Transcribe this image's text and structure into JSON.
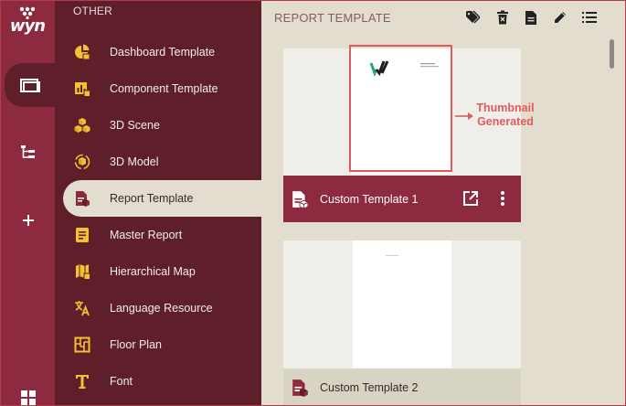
{
  "app": {
    "logo_text": "wyn"
  },
  "rail": {
    "items": [
      "folder-icon",
      "hierarchy-icon",
      "plus-icon",
      "grid-icon"
    ]
  },
  "categories": {
    "title": "OTHER",
    "items": [
      {
        "label": "Dashboard Template",
        "icon": "pie-chart-icon"
      },
      {
        "label": "Component Template",
        "icon": "bar-chart-icon"
      },
      {
        "label": "3D Scene",
        "icon": "cubes-icon"
      },
      {
        "label": "3D Model",
        "icon": "cube-icon"
      },
      {
        "label": "Report Template",
        "icon": "report-icon",
        "active": true
      },
      {
        "label": "Master Report",
        "icon": "master-report-icon"
      },
      {
        "label": "Hierarchical Map",
        "icon": "map-icon"
      },
      {
        "label": "Language Resource",
        "icon": "translate-icon"
      },
      {
        "label": "Floor Plan",
        "icon": "floor-plan-icon"
      },
      {
        "label": "Font",
        "icon": "font-icon"
      }
    ]
  },
  "main": {
    "title": "REPORT TEMPLATE",
    "toolbar": [
      "tag-icon",
      "delete-icon",
      "document-icon",
      "edit-icon",
      "list-icon"
    ],
    "cards": [
      {
        "name": "Custom Template 1"
      },
      {
        "name": "Custom Template 2"
      }
    ],
    "annotation": "Thumbnail Generated"
  },
  "colors": {
    "accent": "#8e2a3f",
    "panel": "#5e1e2a",
    "background": "#e3ddd0",
    "highlight": "#e25b5b",
    "icon_yellow": "#f2c230"
  }
}
